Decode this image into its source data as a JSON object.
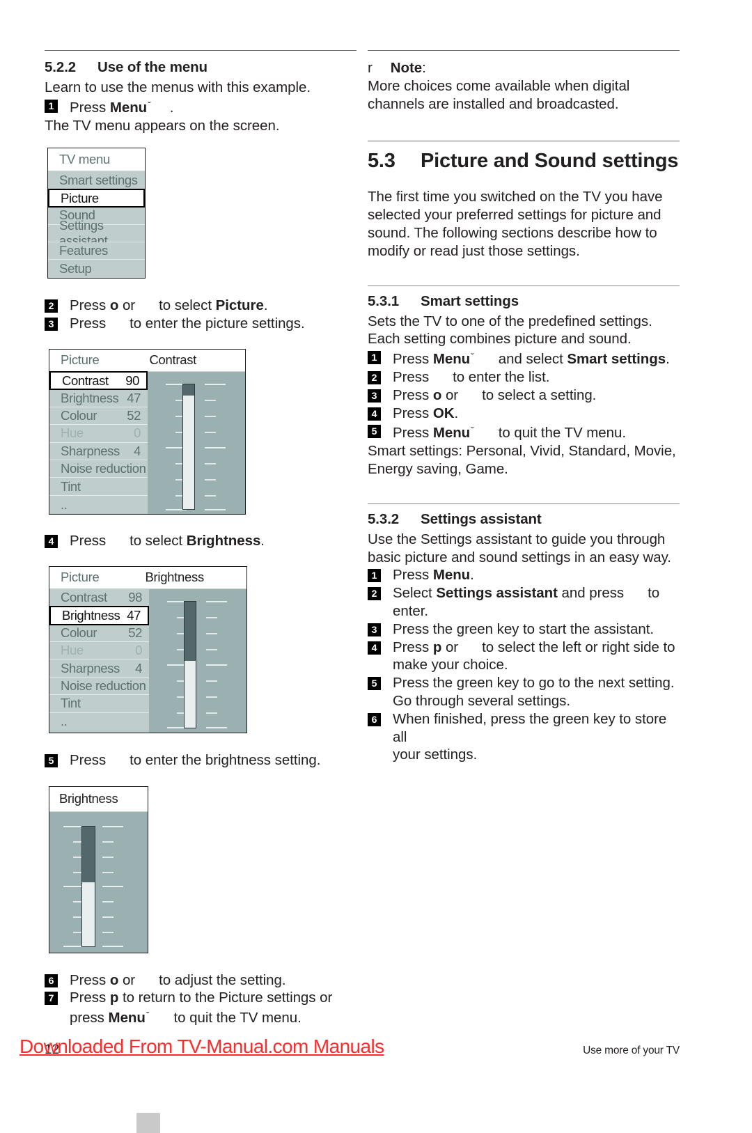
{
  "document": {
    "page_number": "12",
    "footer_right": "Use more of your TV",
    "watermark": "Downloaded From TV-Manual.com Manuals"
  },
  "left_column": {
    "section": {
      "number": "5.2.2",
      "title": "Use of the menu"
    },
    "intro": "Learn to use the menus with this example.",
    "step1": {
      "badge": "1",
      "pre": "Press",
      "key": "Menu",
      "chevron": "ˇ",
      "post": "."
    },
    "after_step1": "The TV menu appears on the screen.",
    "tv_menu": {
      "header": "TV menu",
      "items": [
        {
          "label": "Smart settings",
          "selected": false,
          "dim": false
        },
        {
          "label": "Picture",
          "selected": true,
          "dim": false
        },
        {
          "label": "Sound",
          "selected": false,
          "dim": false
        },
        {
          "label": "Settings assistant",
          "selected": false,
          "dim": false
        },
        {
          "label": "Features",
          "selected": false,
          "dim": false
        },
        {
          "label": "Setup",
          "selected": false,
          "dim": false
        }
      ]
    },
    "step2": {
      "badge": "2",
      "pre": "Press",
      "cursor_a": "o",
      "mid": "or",
      "post": "to select",
      "bold": "Picture",
      "end": "."
    },
    "step3": {
      "badge": "3",
      "pre": "Press",
      "post": "to enter the picture settings."
    },
    "picture_contrast_panel": {
      "header_left": "Picture",
      "header_right": "Contrast",
      "rows": [
        {
          "label": "Contrast",
          "value": "90",
          "selected": true,
          "dim": false
        },
        {
          "label": "Brightness",
          "value": "47",
          "selected": false,
          "dim": false
        },
        {
          "label": "Colour",
          "value": "52",
          "selected": false,
          "dim": false
        },
        {
          "label": "Hue",
          "value": "0",
          "selected": false,
          "dim": true
        },
        {
          "label": "Sharpness",
          "value": "4",
          "selected": false,
          "dim": false
        },
        {
          "label": "Noise reduction",
          "value": "",
          "selected": false,
          "dim": false
        },
        {
          "label": "Tint",
          "value": "",
          "selected": false,
          "dim": false
        },
        {
          "label": "..",
          "value": "",
          "selected": false,
          "dim": false
        }
      ],
      "slider_fill_percent": 9
    },
    "step4": {
      "badge": "4",
      "pre": "Press",
      "post": "to select",
      "bold": "Brightness",
      "end": "."
    },
    "picture_brightness_panel": {
      "header_left": "Picture",
      "header_right": "Brightness",
      "rows": [
        {
          "label": "Contrast",
          "value": "98",
          "selected": false,
          "dim": false
        },
        {
          "label": "Brightness",
          "value": "47",
          "selected": true,
          "dim": false
        },
        {
          "label": "Colour",
          "value": "52",
          "selected": false,
          "dim": false
        },
        {
          "label": "Hue",
          "value": "0",
          "selected": false,
          "dim": true
        },
        {
          "label": "Sharpness",
          "value": "4",
          "selected": false,
          "dim": false
        },
        {
          "label": "Noise reduction",
          "value": "",
          "selected": false,
          "dim": false
        },
        {
          "label": "Tint",
          "value": "",
          "selected": false,
          "dim": false
        },
        {
          "label": "..",
          "value": "",
          "selected": false,
          "dim": false
        }
      ],
      "slider_fill_percent": 47
    },
    "step5": {
      "badge": "5",
      "pre": "Press",
      "post": "to enter the brightness setting."
    },
    "brightness_panel": {
      "header": "Brightness",
      "slider_fill_percent": 47
    },
    "step6": {
      "badge": "6",
      "pre": "Press",
      "cursor_a": "o",
      "mid": "or",
      "post": "to adjust the setting."
    },
    "step7": {
      "badge": "7",
      "pre": "Press",
      "cursor_a": "p",
      "post": "to return to the Picture settings or",
      "cont_pre": "press",
      "cont_key": "Menu",
      "chevron": "ˇ",
      "cont_post": "to quit the TV menu."
    }
  },
  "right_column": {
    "note": {
      "marker": "r",
      "label": "Note",
      "colon": ":",
      "text": "More choices come available when digital channels are installed and broadcasted."
    },
    "section53": {
      "number": "5.3",
      "title": "Picture and Sound settings",
      "body": "The first time you switched on the TV you have selected your preferred settings for picture and sound. The following sections describe how to modify or read just those settings."
    },
    "section531": {
      "number": "5.3.1",
      "title": "Smart settings",
      "body": "Sets the TV to one of the predefined settings. Each setting combines picture and sound.",
      "steps": [
        {
          "badge": "1",
          "pre": "Press",
          "key": "Menu",
          "chevron": "ˇ",
          "post": "and select",
          "bold": "Smart settings",
          "end": "."
        },
        {
          "badge": "2",
          "pre": "Press",
          "post": "to enter the list."
        },
        {
          "badge": "3",
          "pre": "Press",
          "cursor_a": "o",
          "mid": "or",
          "post": "to select a setting."
        },
        {
          "badge": "4",
          "pre": "Press",
          "bold": "OK",
          "end": "."
        },
        {
          "badge": "5",
          "pre": "Press",
          "key": "Menu",
          "chevron": "ˇ",
          "post": "to quit the TV menu."
        }
      ],
      "footer": "Smart settings: Personal, Vivid, Standard, Movie, Energy saving, Game."
    },
    "section532": {
      "number": "5.3.2",
      "title": "Settings assistant",
      "body": "Use the Settings assistant to guide you through basic picture and sound settings in an easy way.",
      "steps": [
        {
          "badge": "1",
          "pre": "Press",
          "bold": "Menu",
          "end": "."
        },
        {
          "badge": "2",
          "pre": "Select",
          "bold": "Settings assistant",
          "post": "and press",
          "end": "to enter."
        },
        {
          "badge": "3",
          "pre": "Press the green key to start the assistant."
        },
        {
          "badge": "4",
          "pre": "Press",
          "cursor_a": "p",
          "mid": "or",
          "post": "to select the left or right side to",
          "cont": "make your choice."
        },
        {
          "badge": "5",
          "pre": "Press the green key to go to the next setting.",
          "cont": "Go through several settings."
        },
        {
          "badge": "6",
          "pre": "When finished, press the green key to store all",
          "cont": "your settings."
        }
      ]
    }
  }
}
